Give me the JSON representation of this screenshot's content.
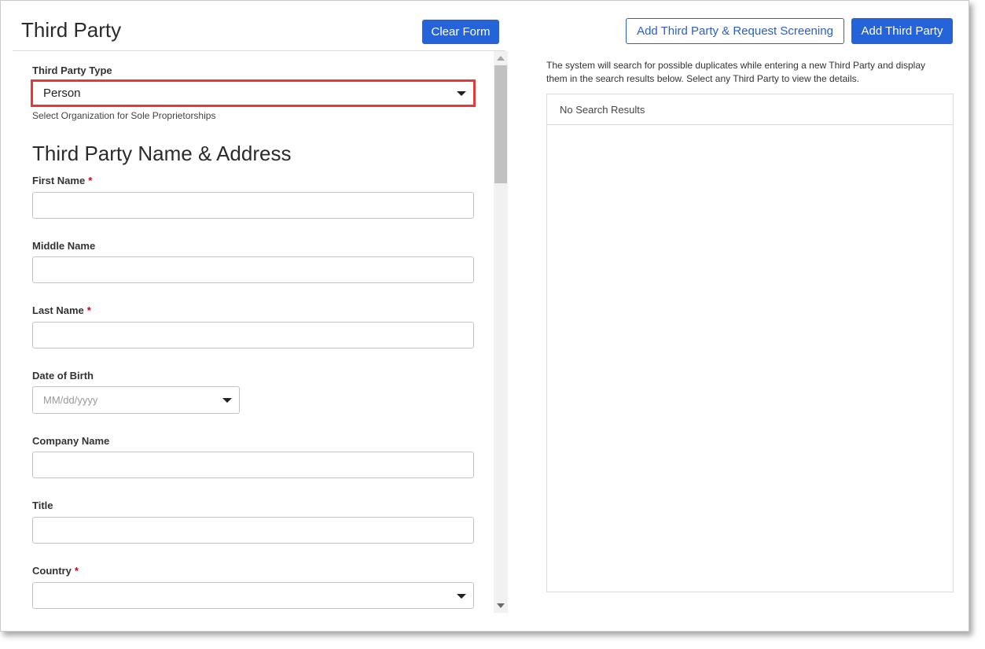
{
  "header": {
    "title": "Third Party",
    "clear_label": "Clear Form",
    "add_screen_label": "Add Third Party & Request Screening",
    "add_label": "Add Third Party"
  },
  "form": {
    "type_label": "Third Party Type",
    "type_value": "Person",
    "type_helper": "Select Organization for Sole Proprietorships",
    "section_title": "Third Party Name & Address",
    "first_name_label": "First Name",
    "middle_name_label": "Middle Name",
    "last_name_label": "Last Name",
    "dob_label": "Date of Birth",
    "dob_placeholder": "MM/dd/yyyy",
    "company_label": "Company Name",
    "title_label": "Title",
    "country_label": "Country",
    "required_mark": "*"
  },
  "results": {
    "info": "The system will search for possible duplicates while entering a new Third Party and display them in the search results below. Select any Third Party to view the details.",
    "empty_text": "No Search Results"
  },
  "colors": {
    "primary": "#2563d8",
    "highlight_border": "#e53935",
    "required": "#d0021b"
  },
  "icons": {
    "dropdown": "caret-down-icon",
    "scroll_up": "arrow-up-icon",
    "scroll_down": "arrow-down-icon"
  }
}
